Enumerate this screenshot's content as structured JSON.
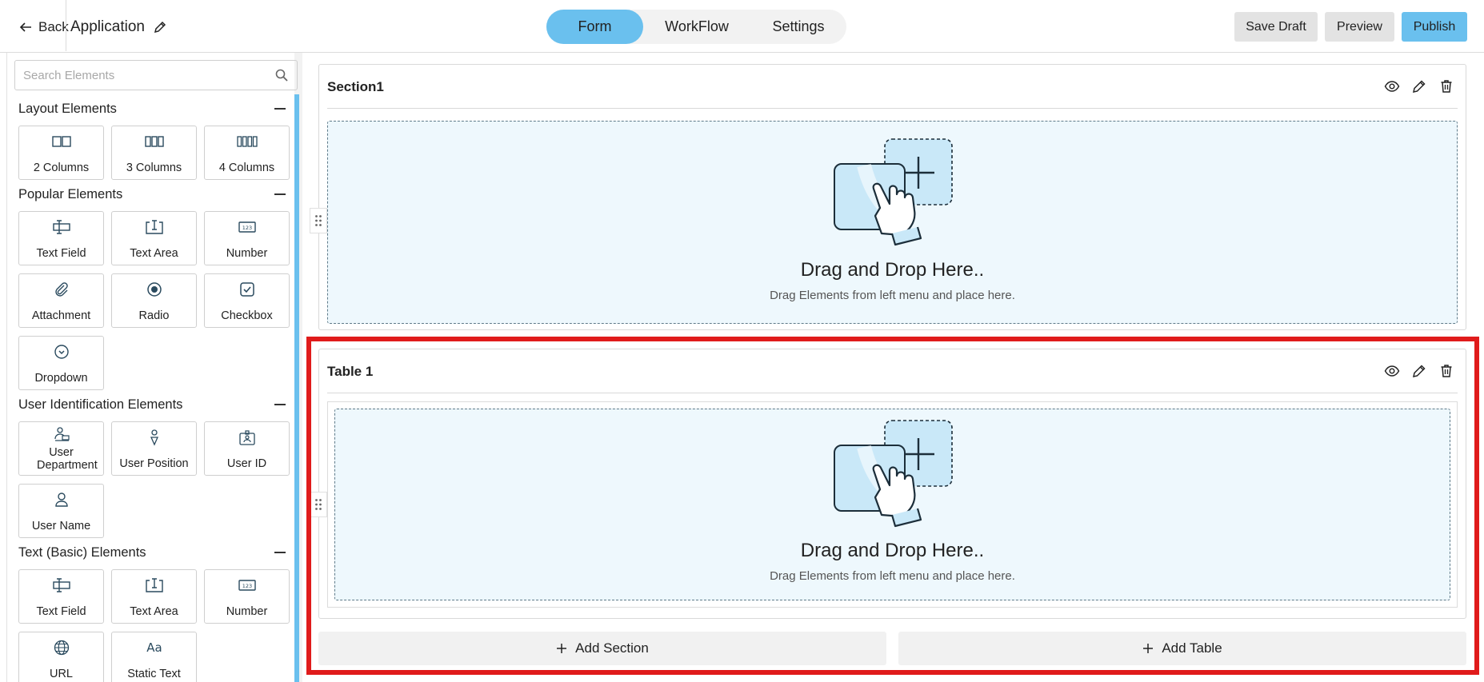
{
  "header": {
    "back_label": "Back",
    "app_title": "Application",
    "tabs": [
      {
        "label": "Form",
        "active": true
      },
      {
        "label": "WorkFlow",
        "active": false
      },
      {
        "label": "Settings",
        "active": false
      }
    ],
    "save_draft_label": "Save Draft",
    "preview_label": "Preview",
    "publish_label": "Publish"
  },
  "sidebar": {
    "search_placeholder": "Search Elements",
    "groups": {
      "layout": {
        "title": "Layout Elements",
        "items": [
          {
            "label": "2 Columns",
            "icon": "two-columns-icon"
          },
          {
            "label": "3 Columns",
            "icon": "three-columns-icon"
          },
          {
            "label": "4 Columns",
            "icon": "four-columns-icon"
          }
        ]
      },
      "popular": {
        "title": "Popular Elements",
        "items": [
          {
            "label": "Text Field",
            "icon": "text-field-icon"
          },
          {
            "label": "Text Area",
            "icon": "text-area-icon"
          },
          {
            "label": "Number",
            "icon": "number-icon"
          },
          {
            "label": "Attachment",
            "icon": "attachment-icon"
          },
          {
            "label": "Radio",
            "icon": "radio-icon"
          },
          {
            "label": "Checkbox",
            "icon": "checkbox-icon"
          },
          {
            "label": "Dropdown",
            "icon": "dropdown-icon"
          }
        ]
      },
      "user": {
        "title": "User Identification Elements",
        "items": [
          {
            "label": "User Department",
            "icon": "user-department-icon"
          },
          {
            "label": "User Position",
            "icon": "user-position-icon"
          },
          {
            "label": "User ID",
            "icon": "user-id-icon"
          },
          {
            "label": "User Name",
            "icon": "user-name-icon"
          }
        ]
      },
      "text_basic": {
        "title": "Text (Basic) Elements",
        "items": [
          {
            "label": "Text Field",
            "icon": "text-field-icon"
          },
          {
            "label": "Text Area",
            "icon": "text-area-icon"
          },
          {
            "label": "Number",
            "icon": "number-icon"
          },
          {
            "label": "URL",
            "icon": "globe-icon"
          },
          {
            "label": "Static Text",
            "icon": "static-text-icon"
          }
        ]
      }
    }
  },
  "canvas": {
    "sections": [
      {
        "title": "Section1",
        "drop_title": "Drag and Drop Here..",
        "drop_subtitle": "Drag Elements from left menu and place here."
      },
      {
        "title": "Table 1",
        "drop_title": "Drag and Drop Here..",
        "drop_subtitle": "Drag Elements from left menu and place here."
      }
    ],
    "add_section_label": "Add Section",
    "add_table_label": "Add Table"
  },
  "colors": {
    "accent": "#6ac0ee",
    "drop_zone_bg": "#eef8fd",
    "highlight": "#e01b1b"
  }
}
